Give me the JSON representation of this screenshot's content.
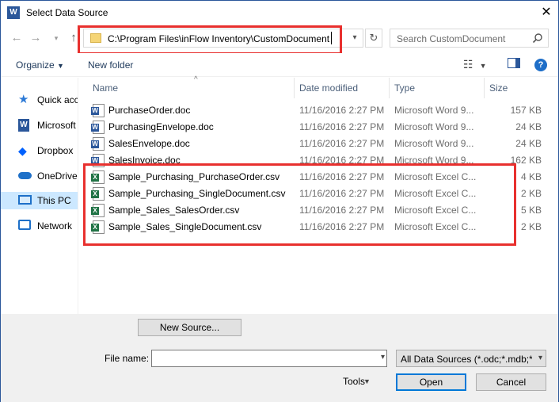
{
  "window": {
    "title": "Select Data Source",
    "app_icon_letter": "W"
  },
  "address": {
    "path": "C:\\Program Files\\inFlow Inventory\\CustomDocument"
  },
  "search": {
    "placeholder": "Search CustomDocument"
  },
  "toolbar": {
    "organize_label": "Organize",
    "new_folder_label": "New folder",
    "help_label": "?"
  },
  "nav": {
    "items": [
      {
        "label": "Quick access",
        "icon": "star-icon"
      },
      {
        "label": "Microsoft Word",
        "icon": "word-icon"
      },
      {
        "label": "Dropbox",
        "icon": "dropbox-icon"
      },
      {
        "label": "OneDrive",
        "icon": "cloud-icon"
      },
      {
        "label": "This PC",
        "icon": "computer-icon",
        "selected": true
      },
      {
        "label": "Network",
        "icon": "network-icon"
      }
    ]
  },
  "columns": {
    "name": "Name",
    "date": "Date modified",
    "type": "Type",
    "size": "Size"
  },
  "files": [
    {
      "name": "PurchaseOrder.doc",
      "date": "11/16/2016 2:27 PM",
      "type": "Microsoft Word 9...",
      "size": "157 KB",
      "kind": "word"
    },
    {
      "name": "PurchasingEnvelope.doc",
      "date": "11/16/2016 2:27 PM",
      "type": "Microsoft Word 9...",
      "size": "24 KB",
      "kind": "word"
    },
    {
      "name": "SalesEnvelope.doc",
      "date": "11/16/2016 2:27 PM",
      "type": "Microsoft Word 9...",
      "size": "24 KB",
      "kind": "word"
    },
    {
      "name": "SalesInvoice.doc",
      "date": "11/16/2016 2:27 PM",
      "type": "Microsoft Word 9...",
      "size": "162 KB",
      "kind": "word"
    },
    {
      "name": "Sample_Purchasing_PurchaseOrder.csv",
      "date": "11/16/2016 2:27 PM",
      "type": "Microsoft Excel C...",
      "size": "4 KB",
      "kind": "excel"
    },
    {
      "name": "Sample_Purchasing_SingleDocument.csv",
      "date": "11/16/2016 2:27 PM",
      "type": "Microsoft Excel C...",
      "size": "2 KB",
      "kind": "excel"
    },
    {
      "name": "Sample_Sales_SalesOrder.csv",
      "date": "11/16/2016 2:27 PM",
      "type": "Microsoft Excel C...",
      "size": "5 KB",
      "kind": "excel"
    },
    {
      "name": "Sample_Sales_SingleDocument.csv",
      "date": "11/16/2016 2:27 PM",
      "type": "Microsoft Excel C...",
      "size": "2 KB",
      "kind": "excel"
    }
  ],
  "bottom": {
    "new_source_label": "New Source...",
    "file_name_label": "File name:",
    "file_name_value": "",
    "filter_value": "All Data Sources (*.odc;*.mdb;*",
    "tools_label": "Tools",
    "open_label": "Open",
    "cancel_label": "Cancel"
  },
  "colors": {
    "highlight": "#e8302e",
    "word": "#2b579a",
    "excel": "#217346",
    "selected": "#cce8ff"
  }
}
